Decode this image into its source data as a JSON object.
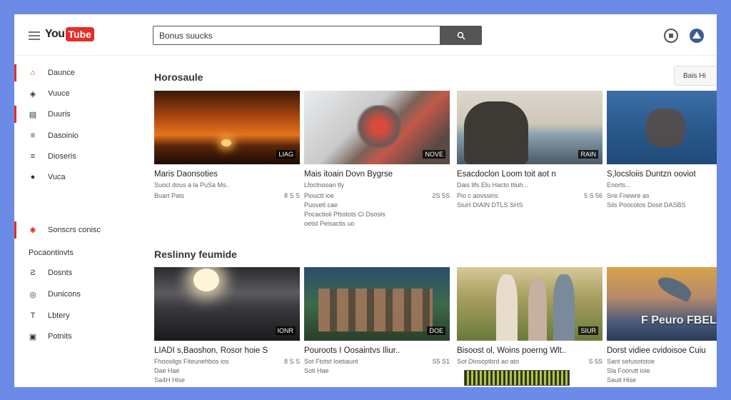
{
  "header": {
    "logo_text": "You",
    "logo_box": "Tube",
    "search_value": "Bonus suucks"
  },
  "sidebar": {
    "items": [
      {
        "label": "Daunce",
        "icon": "home-icon",
        "glyph": "⌂",
        "active": true
      },
      {
        "label": "Vuuce",
        "icon": "trending-icon",
        "glyph": "◈",
        "active": false
      },
      {
        "label": "Duuris",
        "icon": "subscriptions-icon",
        "glyph": "▤",
        "active": true
      },
      {
        "label": "Dasoinio",
        "icon": "library-icon",
        "glyph": "≡",
        "active": false
      },
      {
        "label": "Dioseris",
        "icon": "history-icon",
        "glyph": "≡",
        "active": false
      },
      {
        "label": "Vuca",
        "icon": "globe-icon",
        "glyph": "●",
        "active": false
      }
    ],
    "group2_item": {
      "label": "Sonscrs conisc",
      "icon": "star-icon",
      "glyph": "✱"
    },
    "section_heading": "Pocaontinvts",
    "items2": [
      {
        "label": "Dosnts",
        "icon": "music-icon",
        "glyph": "Ƨ"
      },
      {
        "label": "Dunicons",
        "icon": "gaming-icon",
        "glyph": "◎"
      },
      {
        "label": "Lbtery",
        "icon": "news-icon",
        "glyph": "T"
      },
      {
        "label": "Potnits",
        "icon": "sports-icon",
        "glyph": "▣"
      }
    ]
  },
  "sections": [
    {
      "title": "Horosaule",
      "sort_label": "Bais Hi",
      "videos": [
        {
          "title": "Maris Daonsoties",
          "channel": "Suocl dous a la PuSa Ms..",
          "views": "Buart Pats",
          "age": "8 S S",
          "extra1": "",
          "extra2": "",
          "duration": "LIAG"
        },
        {
          "title": "Mais itoain Dovn Bygrse",
          "channel": "Lfoctnooan tly",
          "views": "Piouctt ioe",
          "age": "2S 5S",
          "extra1": "Puovetl cae",
          "extra2": "Pocactioli Pfsstots Ci Dsosls",
          "extra3": "oetst Peisactis uo",
          "duration": "NOVE"
        },
        {
          "title": "Esacdoclon Loom toit aot n",
          "channel": "Dais lifs Elu Hacto ttiuh...",
          "views": "Pio c aovssiris",
          "age": "5 S 56",
          "extra1": "SiuH DIAIN DTLS SHS",
          "extra2": "",
          "duration": "RAIN"
        },
        {
          "title": "S,locsloiis Duntzn ooviot",
          "channel": "Enorts...",
          "views": "Snii Fnewre as",
          "age": "",
          "extra1": "Sils Poocotos Dosit DASBS",
          "extra2": "",
          "duration": ""
        }
      ]
    },
    {
      "title": "Reslinny feumide",
      "videos": [
        {
          "title": "LIADI s,Baoshon, Rosor hoie S",
          "channel": "Fhoosilgs Fiteunehbos ios",
          "views": "Dae Hae",
          "age": "8 S S",
          "extra1": "Sa4H Hise",
          "duration": "IONR"
        },
        {
          "title": "Pouroots I Oosaintvs Iliur..",
          "channel": "Sot Ftotst Ioetiaunt",
          "views": "Soti Hae",
          "age": "S5 S1",
          "extra1": "",
          "duration": "DOE"
        },
        {
          "title": "Bisoost ol, Woins poerng Wlt..",
          "channel": "Sot Diosoptbrd ao ato",
          "views": "",
          "age": "S 5S",
          "extra1": "",
          "duration": "SIUR"
        },
        {
          "title": "Dorst vidiee cvidoisoe Cuiu",
          "channel": "Sant sefusotstoe",
          "views": "Sla Foorutt ioie",
          "age": "",
          "extra1": "Sauit Hise",
          "duration": ""
        }
      ]
    }
  ],
  "overlay_text": "F Peuro FBEL"
}
